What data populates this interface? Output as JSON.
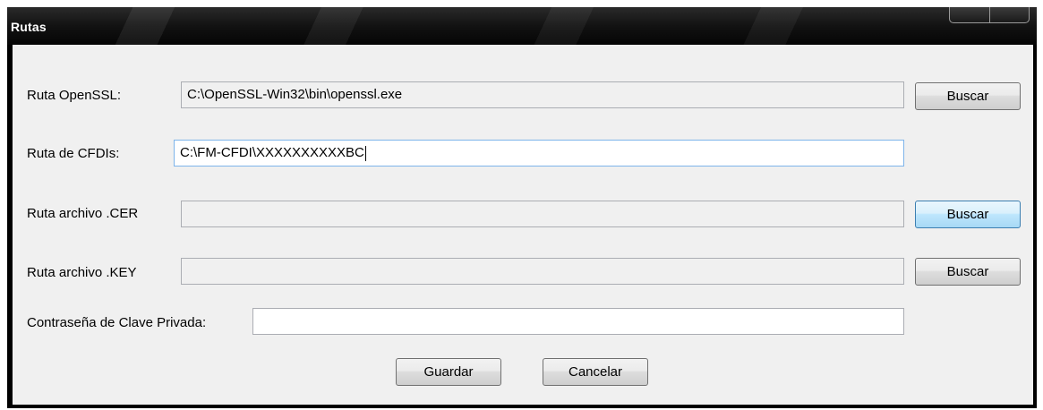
{
  "window": {
    "title": "Rutas"
  },
  "form": {
    "openssl": {
      "label": "Ruta OpenSSL:",
      "value": "C:\\OpenSSL-Win32\\bin\\openssl.exe",
      "button": "Buscar"
    },
    "cfdis": {
      "label": "Ruta de CFDIs:",
      "value": "C:\\FM-CFDI\\XXXXXXXXXXBC"
    },
    "cer": {
      "label": "Ruta archivo .CER",
      "value": "",
      "button": "Buscar"
    },
    "key": {
      "label": "Ruta archivo .KEY",
      "value": "",
      "button": "Buscar"
    },
    "password": {
      "label": "Contraseña de Clave Privada:",
      "value": ""
    },
    "save_label": "Guardar",
    "cancel_label": "Cancelar"
  },
  "colors": {
    "titlebar": "#121212",
    "client_bg": "#f0f0f0",
    "button_hover_border": "#3c7fb1",
    "field_border": "#abadb3"
  }
}
